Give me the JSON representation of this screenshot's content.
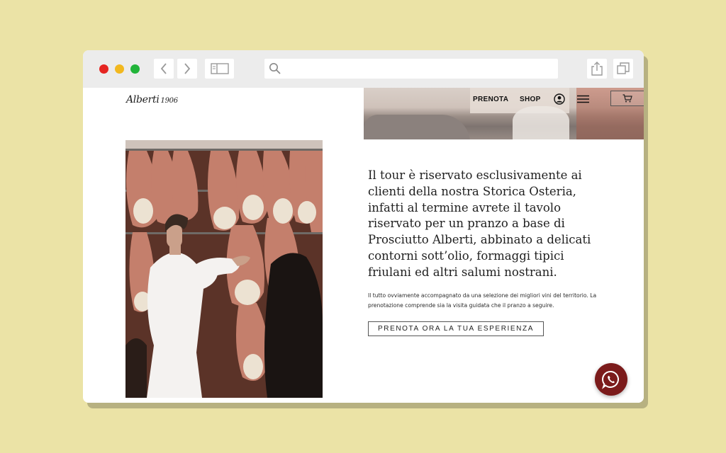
{
  "browser": {
    "icons": {
      "back": "chevron-left-icon",
      "forward": "chevron-right-icon",
      "sidebar": "sidebar-icon",
      "search": "search-icon",
      "share": "share-icon",
      "tabs": "tabs-icon"
    },
    "address_value": ""
  },
  "site": {
    "logo_name": "Alberti",
    "logo_year": "1906",
    "nav": {
      "prenota": "PRENOTA",
      "shop": "SHOP",
      "account_icon": "user-icon",
      "menu_icon": "hamburger-menu-icon",
      "cart_icon": "cart-icon"
    }
  },
  "content": {
    "heading": "Il tour è riservato esclusivamente ai clienti della nostra Storica Osteria, infatti al termine avrete il tavolo riservato per un pranzo a base di Prosciutto Alberti, abbinato a delicati contorni sott’olio, formaggi tipici friulani ed altri salumi nostrani.",
    "body": "Il tutto ovviamente accompagnato da una selezione dei migliori vini del territorio. La prenotazione comprende sia la visita guidata che il pranzo a seguire.",
    "cta_label": "PRENOTA ORA LA TUA ESPERIENZA"
  },
  "floating": {
    "whatsapp_icon": "whatsapp-icon"
  },
  "colors": {
    "background": "#ebe3a6",
    "whatsapp": "#7b1b1b",
    "traffic_red": "#e52521",
    "traffic_yellow": "#f2b81f",
    "traffic_green": "#21b43a"
  }
}
